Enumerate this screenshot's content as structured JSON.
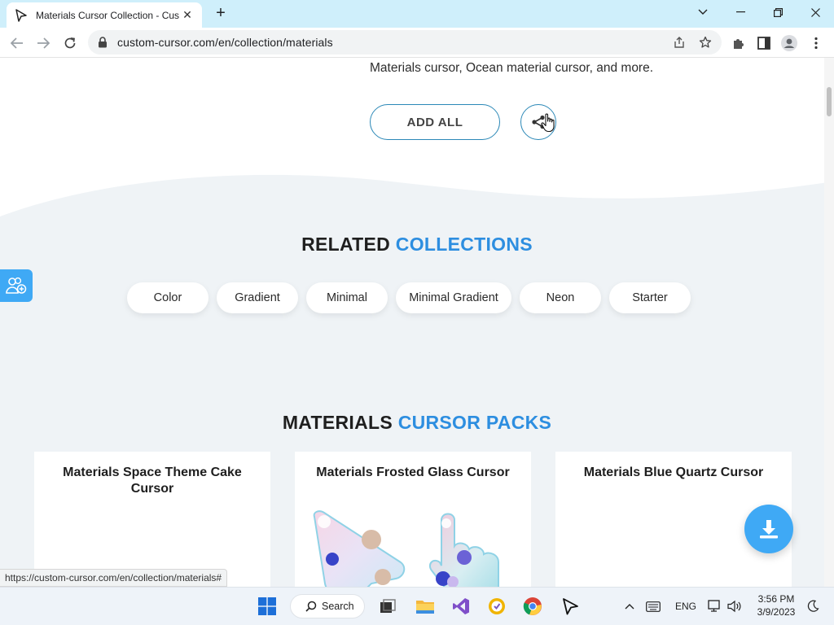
{
  "browser": {
    "tab_title": "Materials Cursor Collection - Custom Cursor",
    "url": "custom-cursor.com/en/collection/materials",
    "status_url": "https://custom-cursor.com/en/collection/materials#"
  },
  "hero": {
    "intro_line": "Materials cursor, Ocean material cursor, and more.",
    "add_all_label": "ADD ALL",
    "share_icon": "share-icon"
  },
  "related": {
    "title_main": "RELATED",
    "title_accent": "COLLECTIONS",
    "chips": [
      "Color",
      "Gradient",
      "Minimal",
      "Minimal Gradient",
      "Neon",
      "Starter"
    ]
  },
  "packs": {
    "title_main": "MATERIALS",
    "title_accent": "CURSOR PACKS",
    "cards": [
      {
        "title": "Materials Space Theme Cake Cursor"
      },
      {
        "title": "Materials Frosted Glass Cursor"
      },
      {
        "title": "Materials Blue Quartz Cursor"
      }
    ]
  },
  "taskbar": {
    "search_label": "Search",
    "language": "ENG",
    "time": "3:56 PM",
    "date": "3/9/2023"
  },
  "colors": {
    "accent": "#2d8ee0",
    "button_border": "#2b88b7",
    "fab": "#3fa9f5",
    "tabbar": "#cfeffb"
  }
}
